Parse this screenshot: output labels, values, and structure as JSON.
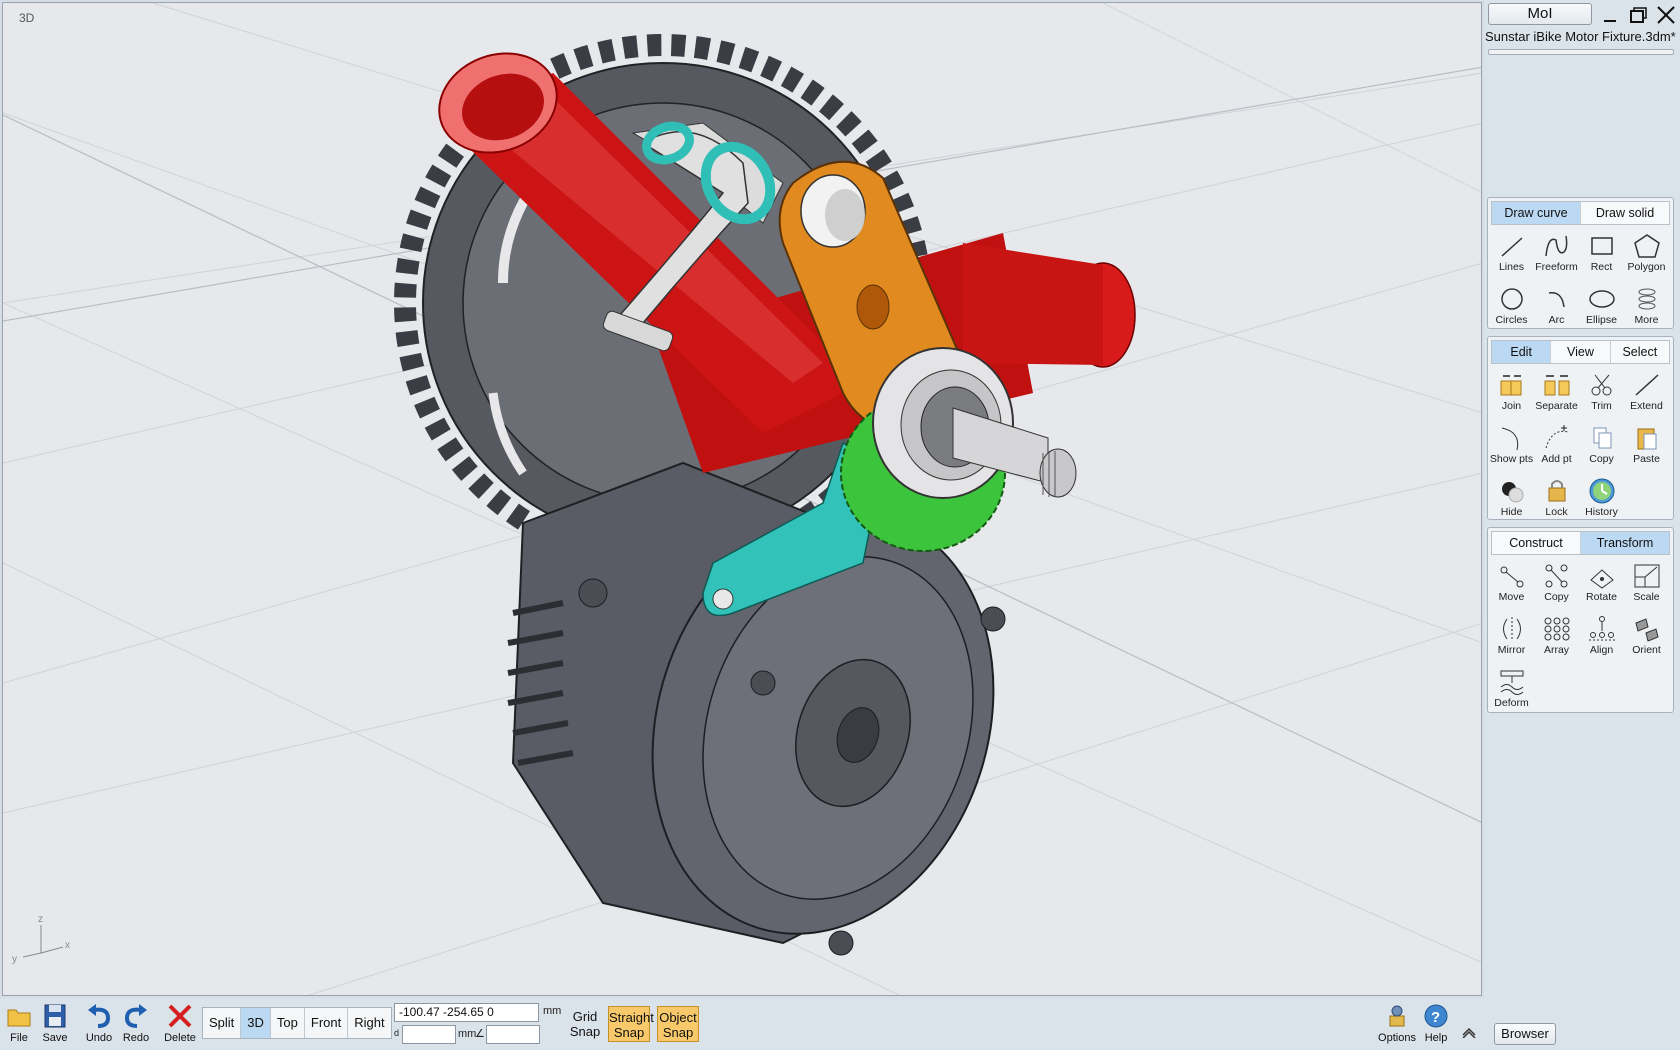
{
  "viewport": {
    "label": "3D",
    "axes": {
      "z": "z",
      "y": "y",
      "x": "x"
    }
  },
  "titlebar": {
    "app_name": "MoI",
    "file_title": "Sunstar iBike Motor Fixture.3dm*"
  },
  "draw_group": {
    "tabs": [
      "Draw curve",
      "Draw solid"
    ],
    "active_tab": "Draw curve",
    "tools": [
      "Lines",
      "Freeform",
      "Rect",
      "Polygon",
      "Circles",
      "Arc",
      "Ellipse",
      "More"
    ]
  },
  "edit_group": {
    "tabs": [
      "Edit",
      "View",
      "Select"
    ],
    "active_tab": "Edit",
    "tools": [
      "Join",
      "Separate",
      "Trim",
      "Extend",
      "Show pts",
      "Add pt",
      "Copy",
      "Paste",
      "Hide",
      "Lock",
      "History"
    ]
  },
  "transform_group": {
    "tabs": [
      "Construct",
      "Transform"
    ],
    "active_tab": "Transform",
    "tools": [
      "Move",
      "Copy",
      "Rotate",
      "Scale",
      "Mirror",
      "Array",
      "Align",
      "Orient",
      "Deform"
    ]
  },
  "bottom": {
    "file": "File",
    "save": "Save",
    "undo": "Undo",
    "redo": "Redo",
    "delete": "Delete",
    "views": [
      "Split",
      "3D",
      "Top",
      "Front",
      "Right"
    ],
    "active_view": "3D",
    "coordinates": "-100.47   -254.65   0",
    "unit_mm": "mm",
    "distance_label": "d",
    "distance_unit": "mm",
    "angle_label": "∠",
    "grid_snap": [
      "Grid",
      "Snap"
    ],
    "straight_snap": [
      "Straight",
      "Snap"
    ],
    "object_snap": [
      "Object",
      "Snap"
    ],
    "options": "Options",
    "help": "Help",
    "browser": "Browser"
  },
  "colors": {
    "active_tab": "#bcd9f3",
    "snap_on": "#f7c96a",
    "tube_red": "#d01414",
    "bracket_orange": "#e0871e",
    "clamp_teal": "#35c7be",
    "gear_green": "#3cc43c"
  }
}
